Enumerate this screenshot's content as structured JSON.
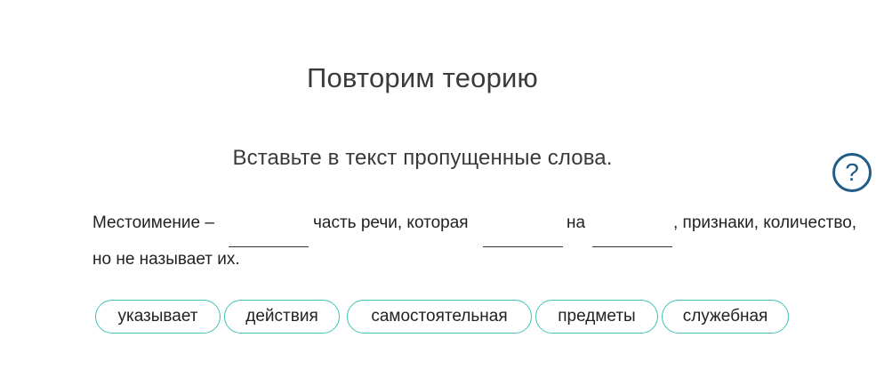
{
  "header": {
    "title": "Повторим теорию"
  },
  "task": {
    "instruction": "Вставьте в текст пропущенные слова.",
    "help_icon": "question-circle-icon",
    "help_symbol": "?"
  },
  "text": {
    "seg1": "Местоимение –",
    "seg2": "часть речи, которая",
    "seg3": "на",
    "seg4": ", признаки, количество,",
    "seg5": "но не называет их."
  },
  "options": [
    {
      "label": "указывает"
    },
    {
      "label": "действия"
    },
    {
      "label": "самостоятельная"
    },
    {
      "label": "предметы"
    },
    {
      "label": "служебная"
    }
  ],
  "colors": {
    "chip_border": "#3fc4b7",
    "help_accent": "#1f5d86"
  }
}
